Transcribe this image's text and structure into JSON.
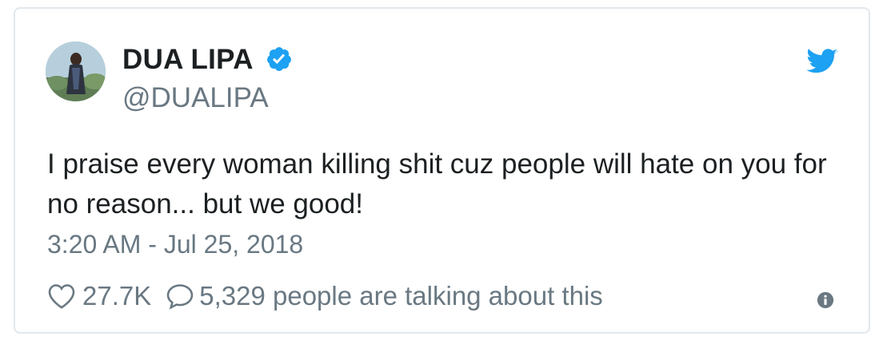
{
  "tweet": {
    "display_name": "DUA LIPA",
    "handle": "@DUALIPA",
    "text": "I praise every woman killing shit cuz people will hate on you for no reason... but we good!",
    "timestamp": "3:20 AM - Jul 25, 2018",
    "likes": "27.7K",
    "replies_text": "5,329 people are talking about this",
    "verified": true
  },
  "icons": {
    "verified": "verified-badge-icon",
    "brand": "twitter-bird-icon",
    "like": "heart-icon",
    "reply": "speech-bubble-icon",
    "info": "info-icon"
  },
  "colors": {
    "brand_blue": "#1da1f2",
    "text": "#1c2022",
    "muted": "#697882",
    "border": "#e1e8ed"
  }
}
